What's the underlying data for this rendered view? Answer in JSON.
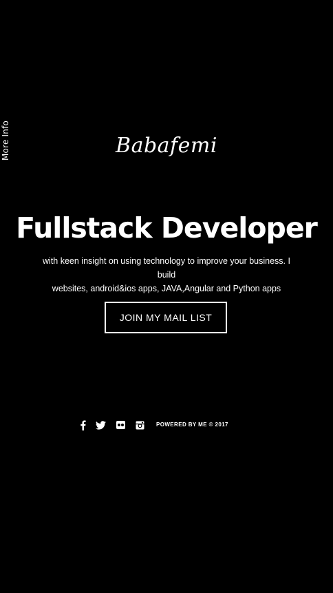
{
  "side_tab": {
    "label": "More Info"
  },
  "hero": {
    "logo_text": "Babafemi",
    "headline": "Fullstack Developer",
    "tagline_line1": "with keen insight on using technology to improve your business. I build",
    "tagline_line2": "websites, android&ios apps, JAVA,Angular and Python apps",
    "cta_label": "JOIN MY MAIL LIST"
  },
  "footer": {
    "social_icons": [
      "facebook-icon",
      "twitter-icon",
      "flickr-icon",
      "instagram-icon"
    ],
    "powered_text": "POWERED BY ME © 2017"
  },
  "colors": {
    "background": "#000000",
    "text": "#ffffff"
  }
}
